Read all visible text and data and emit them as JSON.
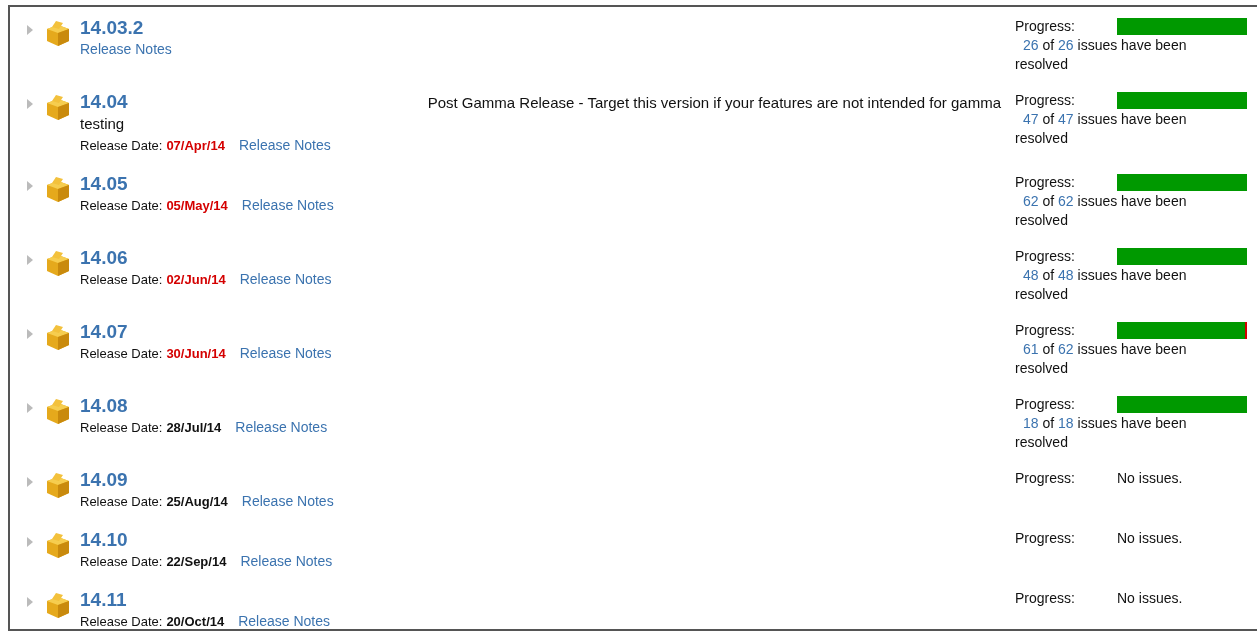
{
  "versions": [
    {
      "name": "14.03.2",
      "release_notes": "Release Notes",
      "progress": {
        "kind": "bar",
        "label": "Progress:",
        "resolved": "26",
        "connector": "of",
        "total": "26",
        "suffix": "issues have been resolved",
        "level": 1
      }
    },
    {
      "name": "14.04",
      "description": "Post Gamma Release - Target this version if your features are not intended for gamma",
      "subtitle": "testing",
      "date_label": "Release Date:",
      "release_date": "07/Apr/14",
      "overdue": true,
      "release_notes": "Release Notes",
      "progress": {
        "kind": "bar",
        "label": "Progress:",
        "resolved": "47",
        "connector": "of",
        "total": "47",
        "suffix": "issues have been resolved",
        "level": 1
      }
    },
    {
      "name": "14.05",
      "date_label": "Release Date:",
      "release_date": "05/May/14",
      "overdue": true,
      "release_notes": "Release Notes",
      "progress": {
        "kind": "bar",
        "label": "Progress:",
        "resolved": "62",
        "connector": "of",
        "total": "62",
        "suffix": "issues have been resolved",
        "level": 1
      }
    },
    {
      "name": "14.06",
      "date_label": "Release Date:",
      "release_date": "02/Jun/14",
      "overdue": true,
      "release_notes": "Release Notes",
      "progress": {
        "kind": "bar",
        "label": "Progress:",
        "resolved": "48",
        "connector": "of",
        "total": "48",
        "suffix": "issues have been resolved",
        "level": 1
      }
    },
    {
      "name": "14.07",
      "date_label": "Release Date:",
      "release_date": "30/Jun/14",
      "overdue": true,
      "release_notes": "Release Notes",
      "progress": {
        "kind": "bar",
        "label": "Progress:",
        "resolved": "61",
        "connector": "of",
        "total": "62",
        "suffix": "issues have been resolved",
        "level": 0.984
      }
    },
    {
      "name": "14.08",
      "date_label": "Release Date:",
      "release_date": "28/Jul/14",
      "overdue": false,
      "release_notes": "Release Notes",
      "progress": {
        "kind": "bar",
        "label": "Progress:",
        "resolved": "18",
        "connector": "of",
        "total": "18",
        "suffix": "issues have been resolved",
        "level": 1
      }
    },
    {
      "name": "14.09",
      "date_label": "Release Date:",
      "release_date": "25/Aug/14",
      "overdue": false,
      "release_notes": "Release Notes",
      "progress": {
        "kind": "none",
        "label": "Progress:",
        "note": "No issues."
      }
    },
    {
      "name": "14.10",
      "date_label": "Release Date:",
      "release_date": "22/Sep/14",
      "overdue": false,
      "release_notes": "Release Notes",
      "progress": {
        "kind": "none",
        "label": "Progress:",
        "note": "No issues."
      }
    },
    {
      "name": "14.11",
      "date_label": "Release Date:",
      "release_date": "20/Oct/14",
      "overdue": false,
      "release_notes": "Release Notes",
      "progress": {
        "kind": "none",
        "label": "Progress:",
        "note": "No issues."
      }
    }
  ]
}
